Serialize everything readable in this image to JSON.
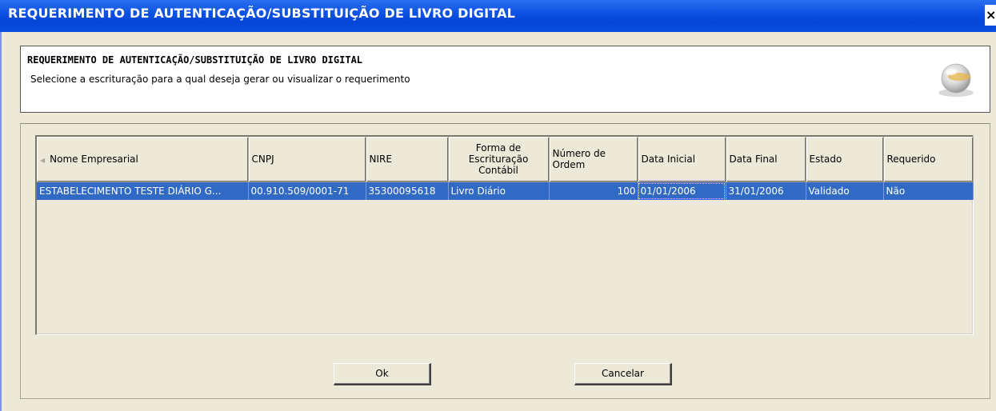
{
  "window": {
    "title": "REQUERIMENTO DE AUTENTICAÇÃO/SUBSTITUIÇÃO DE LIVRO DIGITAL",
    "close_label": "×"
  },
  "header": {
    "title": "REQUERIMENTO DE AUTENTICAÇÃO/SUBSTITUIÇÃO DE LIVRO DIGITAL",
    "subtitle": "Selecione a escrituração para a qual deseja gerar ou visualizar o requerimento",
    "logo_icon": "sped-globe-logo"
  },
  "table": {
    "columns": [
      "Nome Empresarial",
      "CNPJ",
      "NIRE",
      "Forma de Escrituração Contábil",
      "Número de Ordem",
      "Data Inicial",
      "Data Final",
      "Estado",
      "Requerido"
    ],
    "rows": [
      {
        "nome": "ESTABELECIMENTO TESTE DIÁRIO G...",
        "cnpj": "00.910.509/0001-71",
        "nire": "35300095618",
        "forma": "Livro Diário",
        "numero": "100",
        "data_inicial": "01/01/2006",
        "data_final": "31/01/2006",
        "estado": "Validado",
        "requerido": "Não"
      }
    ],
    "selected_row_color": "#316ac5"
  },
  "buttons": {
    "ok_label": "Ok",
    "cancel_label": "Cancelar"
  },
  "colors": {
    "titlebar": "#0a4fe0",
    "background": "#ece9d8",
    "selection": "#316ac5"
  }
}
